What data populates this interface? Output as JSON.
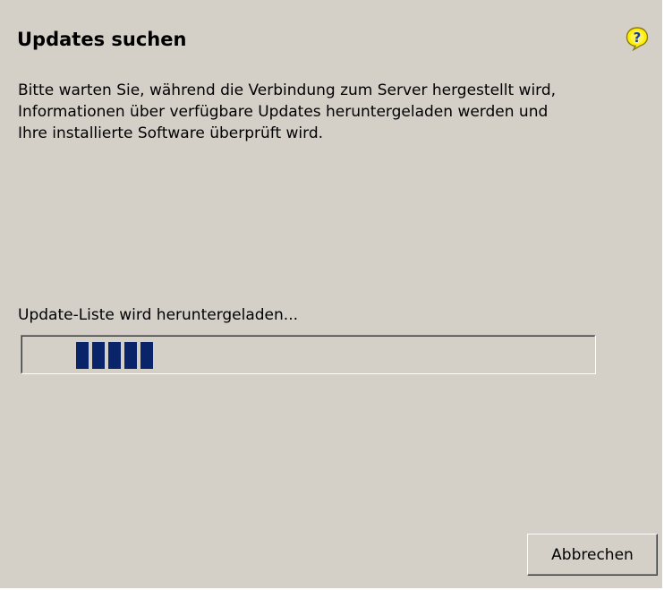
{
  "dialog": {
    "title": "Updates suchen",
    "help_icon": "help-question-icon",
    "description_lines": [
      "Bitte warten Sie, während die Verbindung zum Server hergestellt wird,",
      "Informationen über verfügbare Updates heruntergeladen werden und",
      "Ihre installierte Software überprüft wird."
    ]
  },
  "progress": {
    "status_text": "Update-Liste wird heruntergeladen...",
    "mode": "marquee",
    "filled_blocks": 5,
    "block_color": "#0a246a"
  },
  "buttons": {
    "cancel_label": "Abbrechen"
  },
  "colors": {
    "dialog_background": "#d4d0c8",
    "help_icon_fill": "#ffee00"
  }
}
